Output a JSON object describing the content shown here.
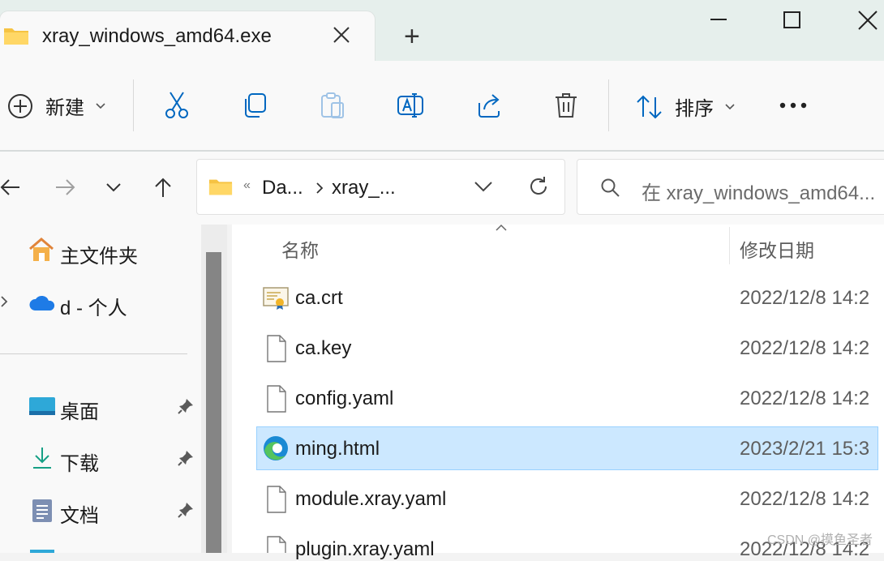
{
  "window": {
    "tab_title": "xray_windows_amd64.exe",
    "new_tab_symbol": "+"
  },
  "toolbar": {
    "new_label": "新建",
    "sort_label": "排序",
    "icons": [
      "cut-icon",
      "copy-icon",
      "paste-icon",
      "rename-icon",
      "share-icon",
      "delete-icon",
      "more-icon"
    ]
  },
  "address": {
    "overflow": "«",
    "crumbs": [
      "Da...",
      "xray_..."
    ],
    "search_placeholder": "在 xray_windows_amd64..."
  },
  "sidebar": {
    "items": [
      {
        "label": "主文件夹",
        "icon": "home-icon"
      },
      {
        "label": "d - 个人",
        "icon": "onedrive-icon"
      },
      {
        "label": "桌面",
        "icon": "desktop-icon",
        "pinned": true
      },
      {
        "label": "下载",
        "icon": "download-icon",
        "pinned": true
      },
      {
        "label": "文档",
        "icon": "documents-icon",
        "pinned": true
      }
    ]
  },
  "columns": {
    "name": "名称",
    "modified": "修改日期"
  },
  "files": [
    {
      "name": "ca.crt",
      "date": "2022/12/8 14:2",
      "icon": "certificate-icon"
    },
    {
      "name": "ca.key",
      "date": "2022/12/8 14:2",
      "icon": "file-icon"
    },
    {
      "name": "config.yaml",
      "date": "2022/12/8 14:2",
      "icon": "file-icon"
    },
    {
      "name": "ming.html",
      "date": "2023/2/21 15:3",
      "icon": "edge-icon",
      "selected": true
    },
    {
      "name": "module.xray.yaml",
      "date": "2022/12/8 14:2",
      "icon": "file-icon"
    },
    {
      "name": "plugin.xray.yaml",
      "date": "2022/12/8 14:2",
      "icon": "file-icon"
    }
  ],
  "watermark": "CSDN @摸鱼圣者",
  "colors": {
    "selection": "#cce8ff",
    "folder": "#f6c343",
    "accent": "#0067c0"
  }
}
